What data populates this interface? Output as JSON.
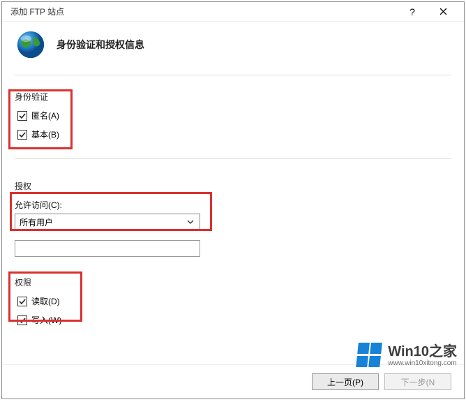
{
  "window": {
    "title": "添加 FTP 站点",
    "help": "?",
    "close": "×"
  },
  "header": {
    "title": "身份验证和授权信息"
  },
  "auth": {
    "section_label": "身份验证",
    "anonymous": "匿名(A)",
    "basic": "基本(B)"
  },
  "authz": {
    "section_label": "授权",
    "allow_label": "允许访问(C):",
    "selected": "所有用户"
  },
  "perms": {
    "section_label": "权限",
    "read": "读取(D)",
    "write": "写入(W)"
  },
  "footer": {
    "prev": "上一页(P)",
    "next": "下一步(N"
  },
  "watermark": {
    "main": "Win10之家",
    "sub": "www.win10xitong.com"
  }
}
